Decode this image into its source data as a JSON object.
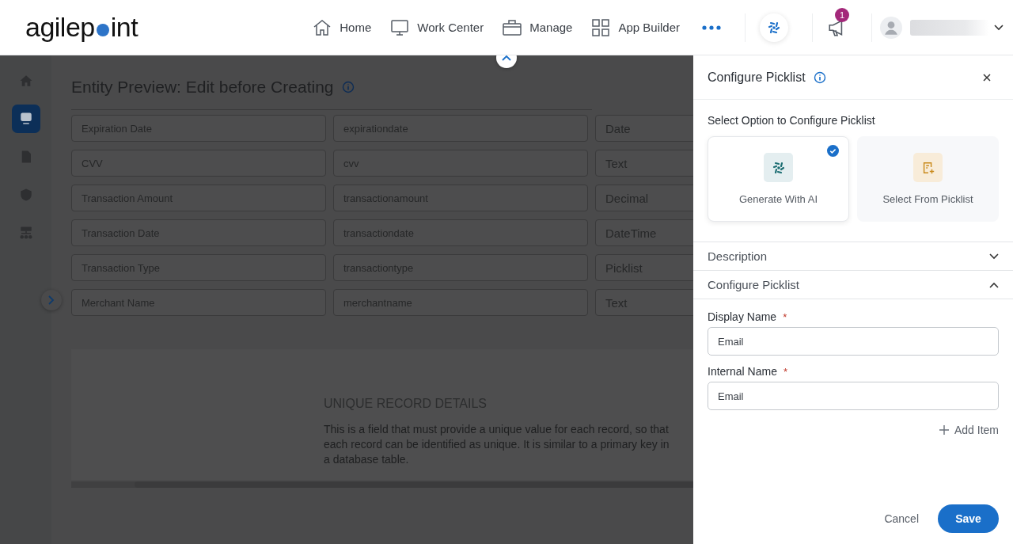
{
  "header": {
    "logo_parts": [
      "agilep",
      "int"
    ],
    "nav": [
      {
        "label": "Home",
        "kind": "home"
      },
      {
        "label": "Work Center",
        "kind": "monitor"
      },
      {
        "label": "Manage",
        "kind": "briefcase"
      },
      {
        "label": "App Builder",
        "kind": "grid"
      }
    ],
    "notification_count": "1"
  },
  "sidebar": {
    "items": [
      {
        "kind": "home",
        "selected": false
      },
      {
        "kind": "monitor",
        "selected": true
      },
      {
        "kind": "document",
        "selected": false
      },
      {
        "kind": "shield",
        "selected": false
      },
      {
        "kind": "hierarchy",
        "selected": false
      }
    ]
  },
  "page": {
    "title": "Entity Preview: Edit before Creating",
    "rows": [
      {
        "display_name": "Expiration Date",
        "internal_name": "expirationdate",
        "type": "Date"
      },
      {
        "display_name": "CVV",
        "internal_name": "cvv",
        "type": "Text"
      },
      {
        "display_name": "Transaction Amount",
        "internal_name": "transactionamount",
        "type": "Decimal"
      },
      {
        "display_name": "Transaction Date",
        "internal_name": "transactiondate",
        "type": "DateTime"
      },
      {
        "display_name": "Transaction Type",
        "internal_name": "transactiontype",
        "type": "Picklist"
      },
      {
        "display_name": "Merchant Name",
        "internal_name": "merchantname",
        "type": "Text"
      }
    ],
    "info": {
      "heading": "UNIQUE RECORD DETAILS",
      "text": "This is a field that must provide a unique value for each record, so that each record can be identified as unique. It is similar to a primary key in a database table."
    }
  },
  "panel": {
    "title": "Configure Picklist",
    "prompt": "Select Option to Configure Picklist",
    "options": [
      {
        "label": "Generate With AI",
        "kind": "ai",
        "selected": true
      },
      {
        "label": "Select From Picklist",
        "kind": "picklist",
        "selected": false
      }
    ],
    "sections": [
      {
        "label": "Description",
        "expanded": false
      },
      {
        "label": "Configure Picklist",
        "expanded": true
      }
    ],
    "fields": [
      {
        "label": "Display Name",
        "required_mark": "*",
        "value": "Email"
      },
      {
        "label": "Internal Name",
        "required_mark": "*",
        "value": "Email"
      }
    ],
    "add_item": "Add Item",
    "cancel": "Cancel",
    "save": "Save"
  }
}
